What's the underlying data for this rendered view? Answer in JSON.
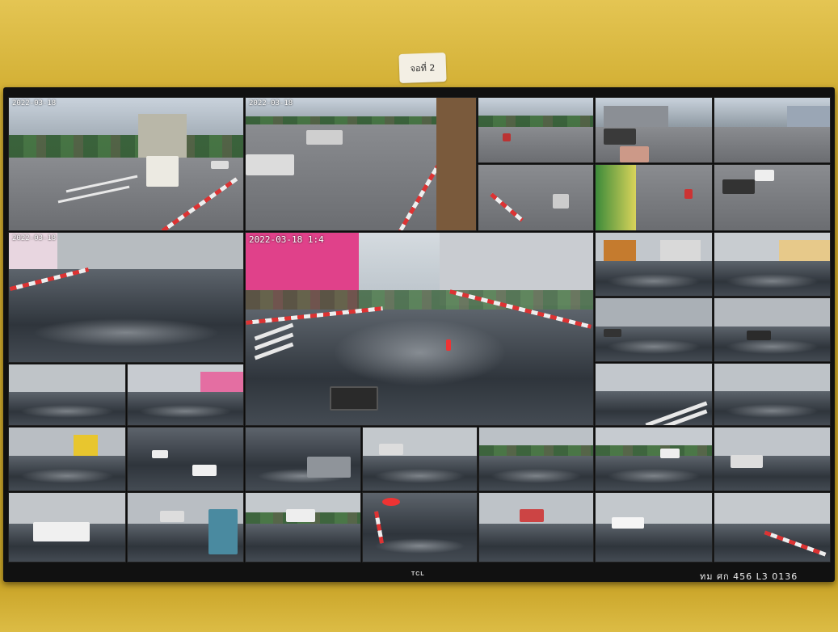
{
  "room": {
    "sticky_note_label": "จอที่ 2",
    "monitor_brand": "TCL",
    "monitor_serial": "ทม ศก 456 L3 0136"
  },
  "cameras": {
    "cam_1": {
      "timestamp": "2022-03-18"
    },
    "cam_2": {
      "timestamp": "2022-03-18"
    },
    "cam_large": {
      "timestamp": "2022-03-18 1:4"
    },
    "cam_left_mid": {
      "timestamp": "2022-03-18"
    }
  },
  "colors": {
    "wall": "#d3b035",
    "bezel": "#111111",
    "road_dry": "#7a7c80",
    "road_wet": "#3a4047",
    "curb_red": "#dd3333",
    "pink_building": "#e0418a"
  }
}
